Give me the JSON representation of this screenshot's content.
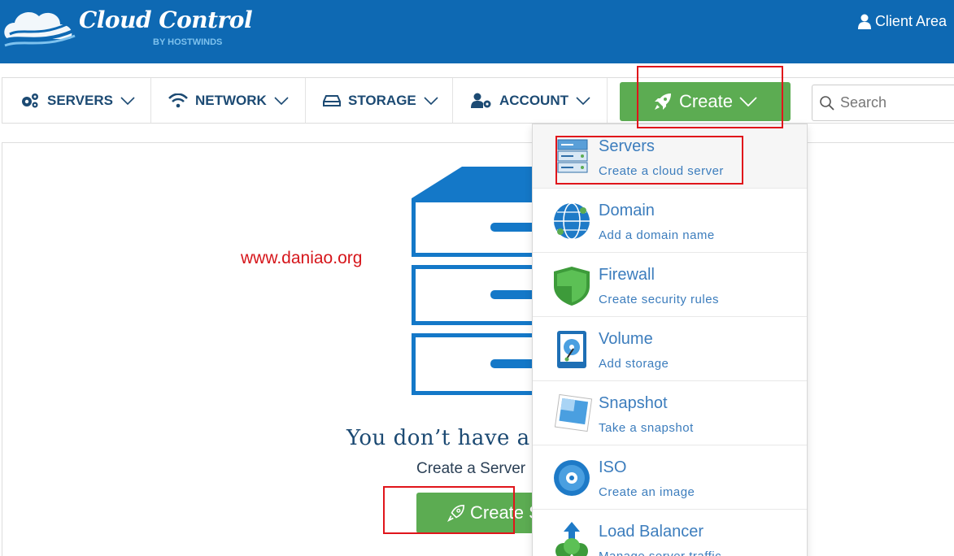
{
  "header": {
    "logo_title": "Cloud Control",
    "logo_sub": "BY HOSTWINDS",
    "client_area": "Client Area"
  },
  "nav": {
    "items": [
      {
        "label": "SERVERS",
        "icon": "gears-icon"
      },
      {
        "label": "NETWORK",
        "icon": "wifi-icon"
      },
      {
        "label": "STORAGE",
        "icon": "hard-drive-icon"
      },
      {
        "label": "ACCOUNT",
        "icon": "user-gear-icon"
      }
    ],
    "create_label": "Create",
    "search_placeholder": "Search"
  },
  "main": {
    "watermark": "www.daniao.org",
    "empty_title": "You don’t have a",
    "empty_subtitle": "Create a Server",
    "create_button": "Create S"
  },
  "dropdown": {
    "items": [
      {
        "label": "Servers",
        "desc": "Create a cloud server",
        "icon": "server-stack-icon"
      },
      {
        "label": "Domain",
        "desc": "Add a domain name",
        "icon": "globe-icon"
      },
      {
        "label": "Firewall",
        "desc": "Create security rules",
        "icon": "shield-icon"
      },
      {
        "label": "Volume",
        "desc": "Add storage",
        "icon": "disk-volume-icon"
      },
      {
        "label": "Snapshot",
        "desc": "Take a snapshot",
        "icon": "photo-snapshot-icon"
      },
      {
        "label": "ISO",
        "desc": "Create an image",
        "icon": "optical-disc-icon"
      },
      {
        "label": "Load Balancer",
        "desc": "Manage server traffic",
        "icon": "load-balancer-icon"
      }
    ]
  },
  "colors": {
    "header_bg": "#0e69b3",
    "nav_text": "#1c4a73",
    "create_green": "#5cac52",
    "dropdown_text": "#3c7dbd",
    "annotation_red": "#e0151b",
    "watermark_red": "#d6161b"
  }
}
